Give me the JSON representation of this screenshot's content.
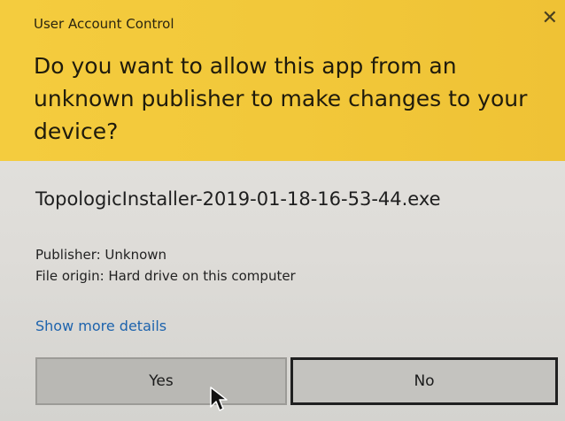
{
  "window": {
    "title": "User Account Control",
    "close_glyph": "✕"
  },
  "prompt": {
    "question": "Do you want to allow this app from an unknown publisher to make changes to your device?",
    "file_name": "TopologicInstaller-2019-01-18-16-53-44.exe",
    "publisher": "Publisher: Unknown",
    "file_origin": "File origin: Hard drive on this computer",
    "details_link": "Show more details"
  },
  "buttons": {
    "yes_label": "Yes",
    "no_label": "No"
  },
  "colors": {
    "banner": "#f2c83a",
    "body_bg": "#dedcd8",
    "link": "#1d63ad"
  },
  "icons": {
    "close": "close-icon",
    "cursor": "mouse-pointer-icon"
  }
}
